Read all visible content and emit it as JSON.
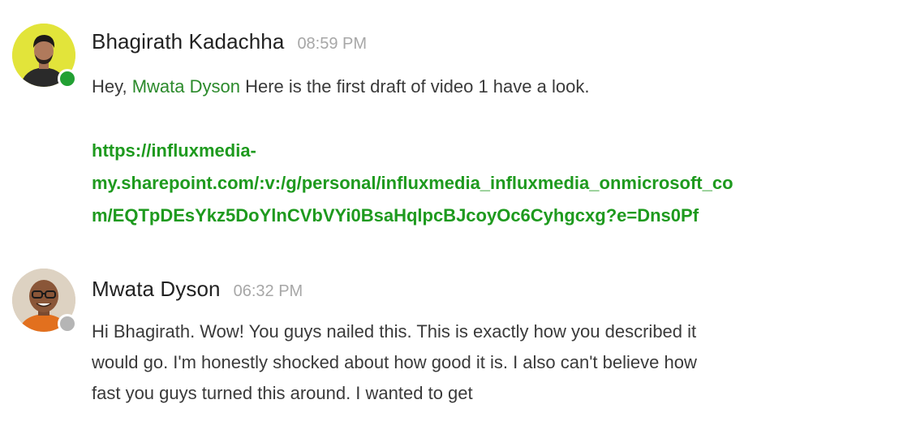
{
  "messages": [
    {
      "author": "Bhagirath Kadachha",
      "time": "08:59 PM",
      "avatar_icon": "user-avatar-photo",
      "presence": "online",
      "text_prefix": "Hey, ",
      "mention": "Mwata Dyson",
      "text_suffix": " Here is the first draft of video 1 have a look.",
      "link_lines": [
        "https://influxmedia-",
        "my.sharepoint.com/:v:/g/personal/influxmedia_influxmedia_onmicrosoft_co",
        "m/EQTpDEsYkz5DoYlnCVbVYi0BsaHqlpcBJcoyOc6Cyhgcxg?e=Dns0Pf"
      ]
    },
    {
      "author": "Mwata Dyson",
      "time": "06:32 PM",
      "avatar_icon": "user-avatar-photo",
      "presence": "away",
      "text_lines": [
        "Hi Bhagirath. Wow! You guys nailed this. This is exactly how you described it",
        "would go. I'm honestly shocked about how good it is. I also can't believe how",
        "fast you guys turned this around. I wanted to get"
      ]
    }
  ],
  "colors": {
    "mention": "#2b8a2b",
    "link": "#1e9a1e",
    "online": "#22a033",
    "away": "#b5b5b5",
    "timestamp": "#a7a7a7"
  }
}
